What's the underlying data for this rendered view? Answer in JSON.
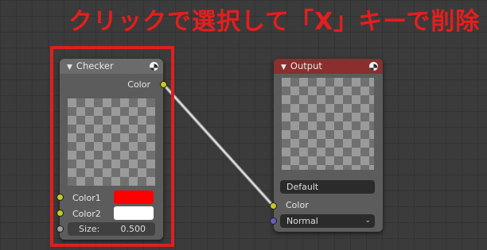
{
  "annotation": "クリックで選択して「X」キーで削除",
  "checker_node": {
    "title": "Checker",
    "output_label": "Color",
    "inputs": [
      {
        "label": "Color1",
        "color": "#ff0000"
      },
      {
        "label": "Color2",
        "color": "#ffffff"
      }
    ],
    "size_label": "Size:",
    "size_value": "0.500",
    "header_color": "#6b6b6b"
  },
  "output_node": {
    "title": "Output",
    "text_field": "Default",
    "input_label": "Color",
    "dropdown_value": "Normal",
    "header_color": "#8a2e2e"
  },
  "colors": {
    "annotation": "#e51e1e",
    "highlight": "#e01e1e",
    "socket_color": "#c8c820",
    "socket_float": "#a0a0a0",
    "socket_shader": "#6060c0"
  },
  "icons": [
    "collapse-arrow-icon",
    "material-globe-icon",
    "dropdown-chevron-icon"
  ]
}
